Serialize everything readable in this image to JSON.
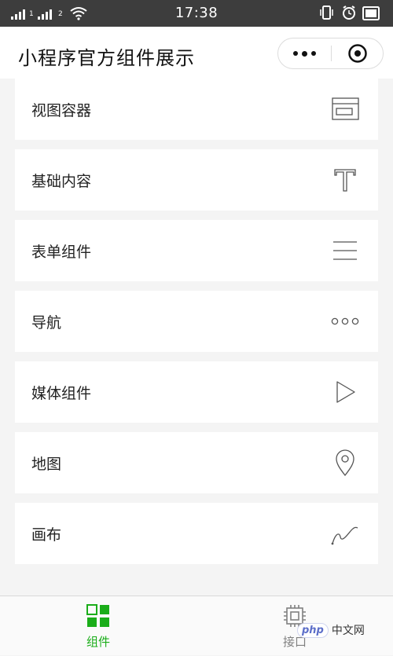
{
  "status_bar": {
    "time": "17:38",
    "network_labels": [
      "1",
      "2"
    ]
  },
  "navbar": {
    "title": "小程序官方组件展示"
  },
  "list": {
    "items": [
      {
        "label": "视图容器",
        "icon": "view-container-icon"
      },
      {
        "label": "基础内容",
        "icon": "text-icon"
      },
      {
        "label": "表单组件",
        "icon": "form-lines-icon"
      },
      {
        "label": "导航",
        "icon": "more-dots-icon"
      },
      {
        "label": "媒体组件",
        "icon": "play-icon"
      },
      {
        "label": "地图",
        "icon": "map-pin-icon"
      },
      {
        "label": "画布",
        "icon": "canvas-curve-icon"
      }
    ]
  },
  "tab_bar": {
    "tabs": [
      {
        "label": "组件",
        "active": true,
        "icon": "components-grid-icon"
      },
      {
        "label": "接口",
        "active": false,
        "icon": "chip-icon"
      }
    ]
  },
  "watermark": {
    "logo": "php",
    "text": "中文网"
  },
  "colors": {
    "accent": "#1aad19",
    "status_bar": "#3d3d3d",
    "background": "#f4f4f4",
    "inactive": "#808080"
  }
}
